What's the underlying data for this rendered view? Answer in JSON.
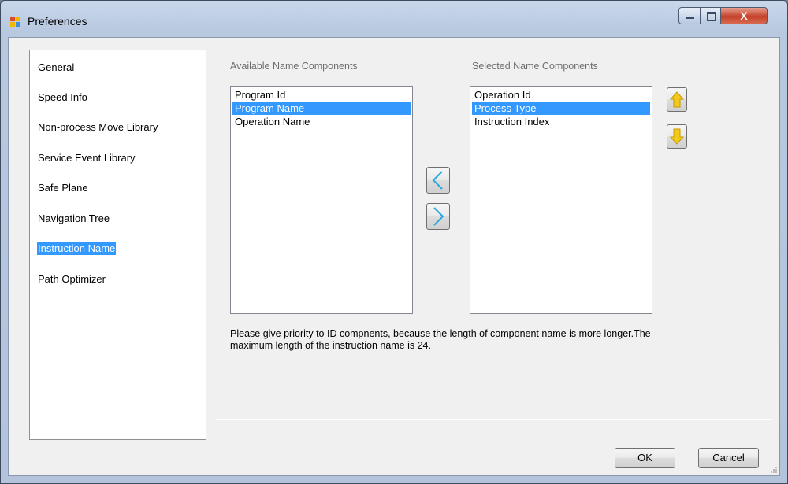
{
  "window": {
    "title": "Preferences",
    "icon": "app-grid-icon",
    "controls": {
      "close_label": "X"
    }
  },
  "nav": {
    "items": [
      {
        "label": "General",
        "selected": false
      },
      {
        "label": "Speed Info",
        "selected": false
      },
      {
        "label": "Non-process Move Library",
        "selected": false
      },
      {
        "label": "Service Event Library",
        "selected": false
      },
      {
        "label": "Safe Plane",
        "selected": false
      },
      {
        "label": "Navigation Tree",
        "selected": false
      },
      {
        "label": "Instruction Name",
        "selected": true
      },
      {
        "label": "Path Optimizer",
        "selected": false
      }
    ]
  },
  "available": {
    "label": "Available Name Components",
    "items": [
      {
        "label": "Program Id",
        "selected": false
      },
      {
        "label": "Program Name",
        "selected": true
      },
      {
        "label": "Operation Name",
        "selected": false
      }
    ]
  },
  "selected": {
    "label": "Selected Name Components",
    "items": [
      {
        "label": "Operation Id",
        "selected": false
      },
      {
        "label": "Process Type",
        "selected": true
      },
      {
        "label": "Instruction Index",
        "selected": false
      }
    ]
  },
  "note": "Please give priority to ID compnents, because the length of component name is more longer.The maximum length of the instruction name is 24.",
  "buttons": {
    "ok": "OK",
    "cancel": "Cancel"
  },
  "colors": {
    "selection": "#3399ff",
    "arrow": "#2aa7e0",
    "updown": "#f3c91c"
  }
}
